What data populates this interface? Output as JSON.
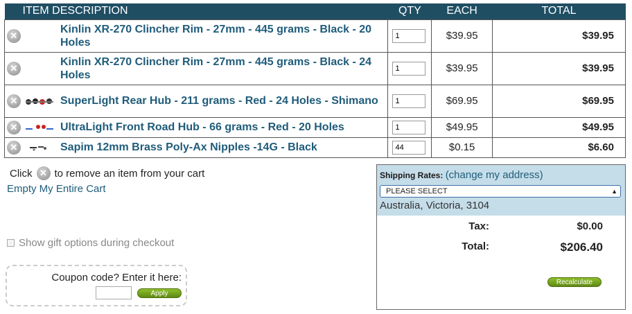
{
  "table": {
    "headers": {
      "item": "ITEM",
      "description": "DESCRIPTION",
      "qty": "QTY",
      "each": "EACH",
      "total": "TOTAL"
    },
    "rows": [
      {
        "description": "Kinlin XR-270 Clincher Rim - 27mm - 445 grams - Black - 20 Holes",
        "qty": "1",
        "each": "$39.95",
        "total": "$39.95",
        "image": "none"
      },
      {
        "description": "Kinlin XR-270 Clincher Rim - 27mm - 445 grams - Black - 24 Holes",
        "qty": "1",
        "each": "$39.95",
        "total": "$39.95",
        "image": "none"
      },
      {
        "description": "SuperLight Rear Hub - 211 grams - Red - 24 Holes - Shimano",
        "qty": "1",
        "each": "$69.95",
        "total": "$69.95",
        "image": "rear-hub-thumbnail"
      },
      {
        "description": "UltraLight Front Road Hub - 66 grams - Red - 20 Holes",
        "qty": "1",
        "each": "$49.95",
        "total": "$49.95",
        "image": "front-hub-thumbnail"
      },
      {
        "description": "Sapim 12mm Brass Poly-Ax Nipples -14G - Black",
        "qty": "44",
        "each": "$0.15",
        "total": "$6.60",
        "image": "nipples-thumbnail"
      }
    ],
    "remove_icon": "remove-x-icon"
  },
  "help": {
    "before": "Click",
    "after": "to remove an item from your cart"
  },
  "empty_cart": "Empty My Entire Cart",
  "gift_option": "Show gift options during checkout",
  "coupon": {
    "label": "Coupon code? Enter it here:",
    "apply": "Apply",
    "value": ""
  },
  "shipping": {
    "label": "Shipping Rates:",
    "change_link": "(change my address)",
    "select_value": "PLEASE SELECT",
    "address": "Australia, Victoria, 3104"
  },
  "totals": {
    "tax_label": "Tax:",
    "tax_value": "$0.00",
    "total_label": "Total:",
    "total_value": "$206.40"
  },
  "recalculate": "Recalculate",
  "colors": {
    "header_bg": "#1f4e63",
    "link": "#1f5c7a",
    "shipping_bg": "#c5dde9",
    "button_green": "#6d9c1a"
  }
}
